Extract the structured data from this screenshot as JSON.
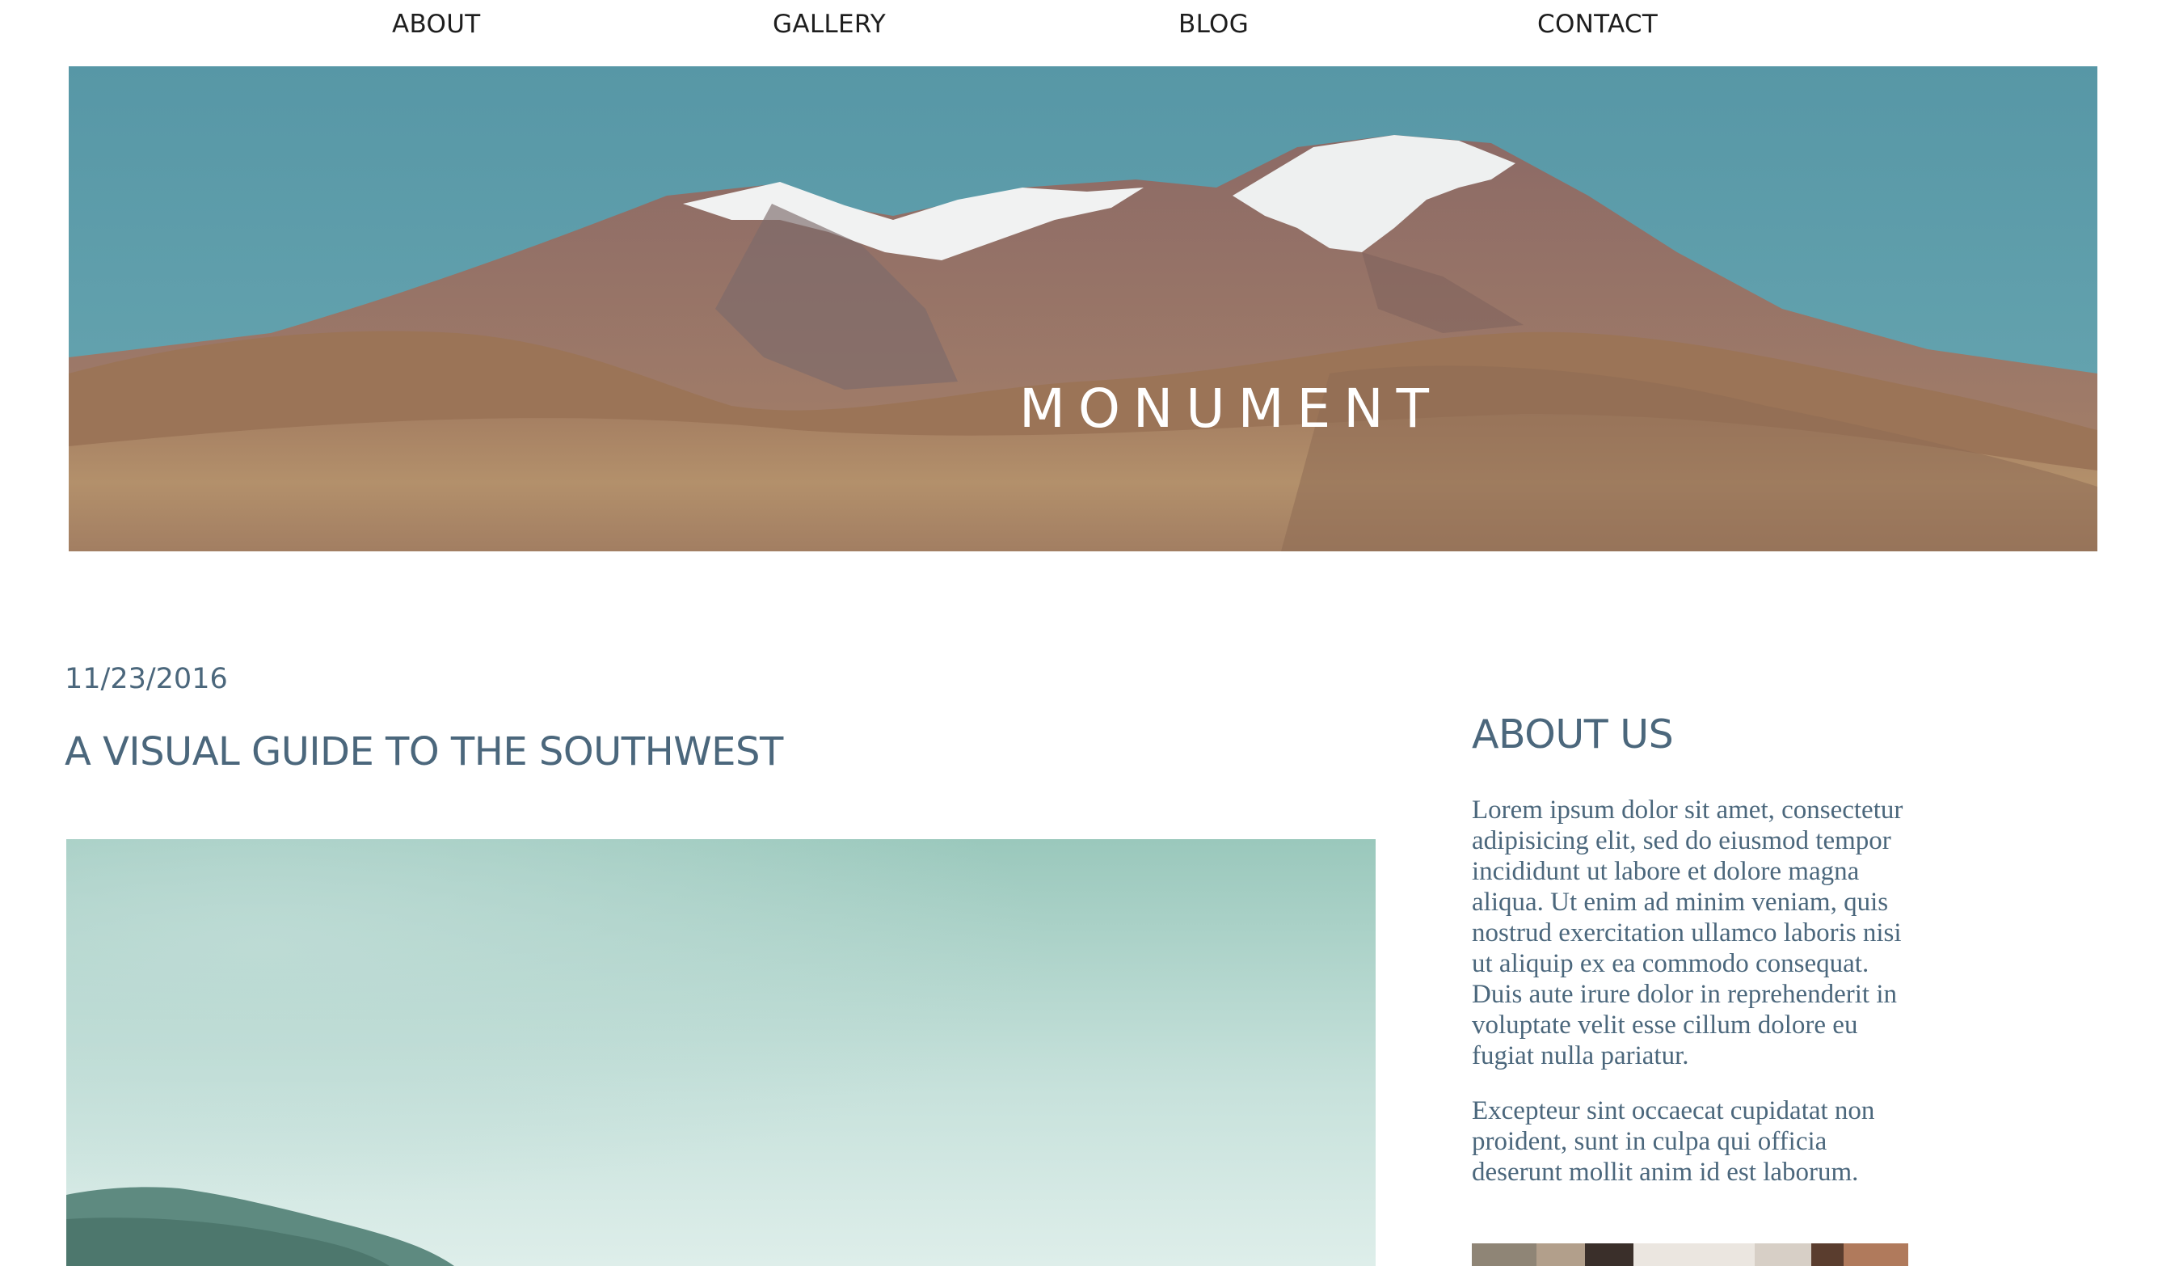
{
  "nav": {
    "about": "ABOUT",
    "gallery": "GALLERY",
    "blog": "BLOG",
    "contact": "CONTACT"
  },
  "hero": {
    "title": "MONUMENT"
  },
  "post": {
    "date": "11/23/2016",
    "title": "A VISUAL GUIDE TO THE SOUTHWEST"
  },
  "sidebar": {
    "heading": "ABOUT US",
    "paragraphs": [
      "Lorem ipsum dolor sit amet, consectetur adipisicing elit, sed do eiusmod tempor incididunt ut labore et dolore magna aliqua. Ut enim ad minim veniam, quis nostrud exercitation ullamco laboris nisi ut aliquip ex ea commodo consequat. Duis aute irure dolor in reprehenderit in voluptate velit esse cillum dolore eu fugiat nulla pariatur.",
      "Excepteur sint occaecat cupidatat non proident, sunt in culpa qui officia deserunt mollit anim id est laborum."
    ]
  },
  "colors": {
    "accent": "#4b677c",
    "nav_text": "#1e1e1e",
    "hero_sky": "#5b9aa8"
  }
}
